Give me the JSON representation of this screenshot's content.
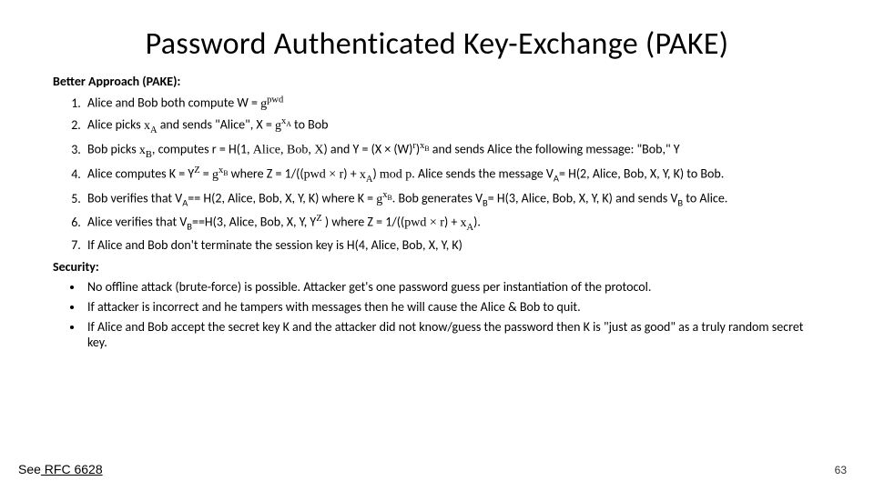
{
  "title": "Password Authenticated Key-Exchange (PAKE)",
  "approach_label": "Better Approach (PAKE):",
  "steps": {
    "s1a": "Alice and Bob both compute W = ",
    "s1b": "g",
    "s1c": "pwd",
    "s2a": "Alice picks ",
    "s2xA": "x",
    "s2A": "A",
    "s2b": " and sends \"Alice\", X = ",
    "s2g": "g",
    "s2exp1": "x",
    "s2exp2": "A",
    "s2c": " to Bob",
    "s3a": "Bob picks ",
    "s3xB": "x",
    "s3B": "B",
    "s3b": ", computes r = H(1, ",
    "s3names": "Alice, Bob, X",
    "s3c": ") and  Y = (X × (W)",
    "s3r": "r",
    "s3d": ")",
    "s3e": " and sends Alice the following message:   \"Bob,\" Y",
    "s4a": "Alice computes K = Y",
    "s4Z": "Z",
    "s4b": " = ",
    "s4g": "g",
    "s4xB": "x",
    "s4Bs": "B",
    "s4c": " where Z = 1/((",
    "s4d": "pwd × r",
    "s4e": ") + ",
    "s4xA": "x",
    "s4As": "A",
    "s4f": ")  ",
    "s4mod": "mod p",
    "s4g2": ".   Alice sends the message V",
    "s4Aa": "A",
    "s4h": "= H(2, Alice, Bob, X, Y, K) to Bob.",
    "s5a": "Bob verifies that V",
    "s5A": "A",
    "s5b": "== H(2, Alice, Bob, X, Y, K) where K =  ",
    "s5g": "g",
    "s5xB": "x",
    "s5Bs": "B",
    "s5c": ". Bob generates V",
    "s5Bb": "B",
    "s5d": "= H(3, Alice, Bob, X, Y, K) and sends V",
    "s5Bb2": "B",
    "s5e": " to Alice.",
    "s6a": "Alice verifies that V",
    "s6B": "B",
    "s6b": "==H(3, Alice, Bob, X, Y, Y",
    "s6Z": "Z",
    "s6c": " ) where Z = 1/((",
    "s6d": "pwd × r",
    "s6e": ") + ",
    "s6xA": "x",
    "s6As": "A",
    "s6f": ").",
    "s7": "If Alice and Bob don't terminate the session key is H(4, Alice, Bob, X, Y, K)"
  },
  "security_label": "Security:",
  "security": {
    "b1": "No offline attack (brute-force) is possible. Attacker get's one password guess per instantiation of the protocol.",
    "b2": "If attacker is incorrect and he tampers with messages then he will cause the Alice & Bob to quit.",
    "b3": "If Alice and Bob accept the secret key K and the attacker did not know/guess the password then K is \"just as good\" as a truly random secret key."
  },
  "footer_see": "See",
  "footer_rfc": " RFC 6628",
  "page_number": "63"
}
